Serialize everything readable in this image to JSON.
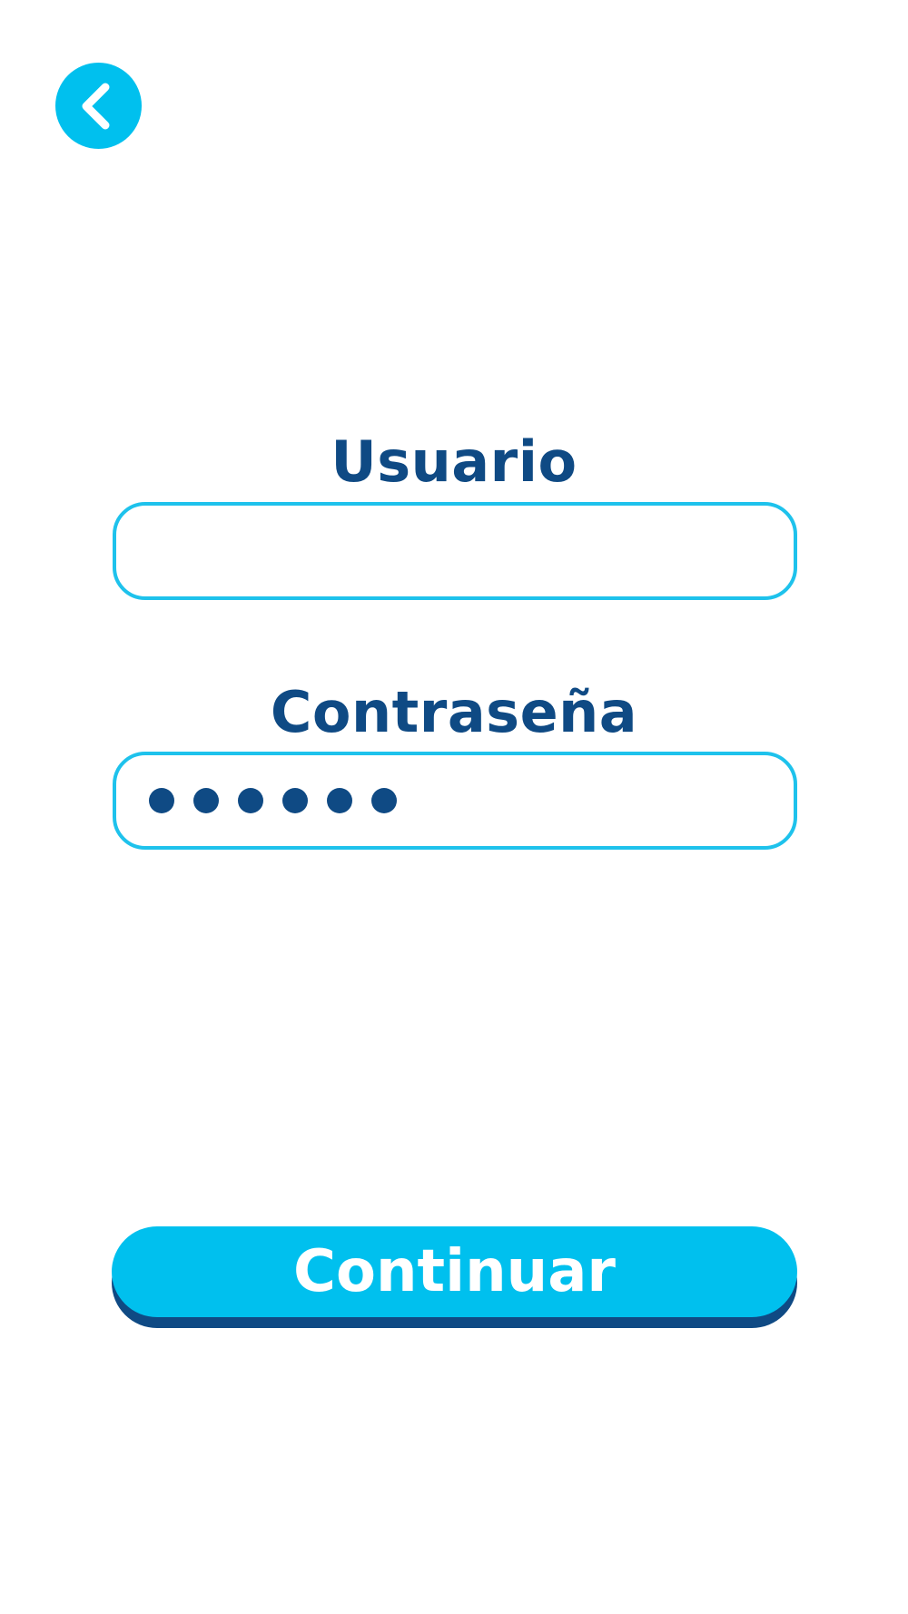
{
  "header": {
    "back_icon": "chevron-left-icon"
  },
  "form": {
    "username": {
      "label": "Usuario",
      "value": "",
      "placeholder": ""
    },
    "password": {
      "label": "Contraseña",
      "masked_length": 6
    }
  },
  "actions": {
    "continue_label": "Continuar"
  },
  "colors": {
    "accent": "#00c0ee",
    "text_primary": "#0f4a84",
    "field_border": "#1ec2ec",
    "button_shadow": "#0f4a84"
  }
}
